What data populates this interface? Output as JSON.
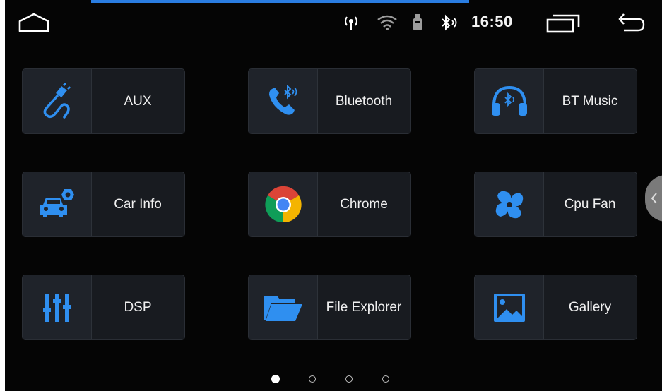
{
  "status": {
    "time": "16:50"
  },
  "apps": [
    {
      "label": "AUX",
      "icon": "aux-cable-icon"
    },
    {
      "label": "Bluetooth",
      "icon": "bluetooth-phone-icon"
    },
    {
      "label": "BT Music",
      "icon": "headphones-icon"
    },
    {
      "label": "Car Info",
      "icon": "car-info-icon"
    },
    {
      "label": "Chrome",
      "icon": "chrome-icon"
    },
    {
      "label": "Cpu Fan",
      "icon": "fan-icon"
    },
    {
      "label": "DSP",
      "icon": "equalizer-icon"
    },
    {
      "label": "File Explorer",
      "icon": "folder-icon"
    },
    {
      "label": "Gallery",
      "icon": "image-icon"
    }
  ],
  "pager": {
    "pages": 4,
    "current": 1
  },
  "colors": {
    "accent": "#2a7de1",
    "icon_blue": "#2f8ff0",
    "background": "#050505"
  }
}
